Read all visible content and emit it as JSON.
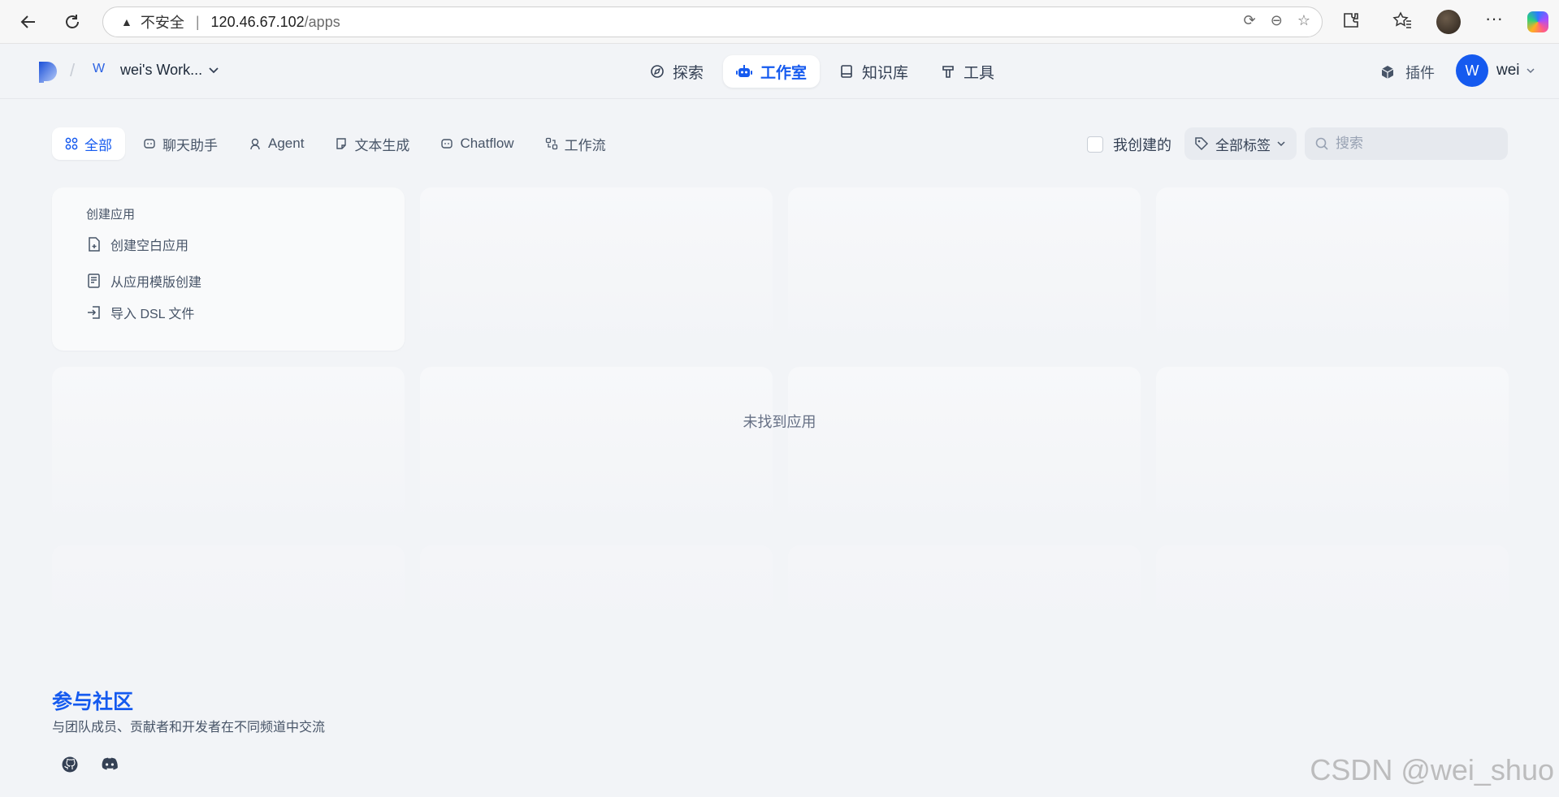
{
  "browser": {
    "insecure_label": "不安全",
    "url_host": "120.46.67.102",
    "url_path": "/apps"
  },
  "header": {
    "workspace_initial": "W",
    "workspace_name": "wei's Work...",
    "nav": [
      {
        "label": "探索",
        "icon": "compass-icon"
      },
      {
        "label": "工作室",
        "icon": "robot-icon"
      },
      {
        "label": "知识库",
        "icon": "book-icon"
      },
      {
        "label": "工具",
        "icon": "hammer-icon"
      }
    ],
    "plugins_label": "插件",
    "avatar_initial": "W",
    "username": "wei"
  },
  "tabs": [
    {
      "label": "全部",
      "icon": "grid-icon"
    },
    {
      "label": "聊天助手",
      "icon": "chat-icon"
    },
    {
      "label": "Agent",
      "icon": "agent-icon"
    },
    {
      "label": "文本生成",
      "icon": "document-icon"
    },
    {
      "label": "Chatflow",
      "icon": "chatflow-icon"
    },
    {
      "label": "工作流",
      "icon": "workflow-icon"
    }
  ],
  "filters": {
    "mine_label": "我创建的",
    "tags_label": "全部标签",
    "search_placeholder": "搜索"
  },
  "create": {
    "title": "创建应用",
    "items": [
      "创建空白应用",
      "从应用模版创建",
      "导入 DSL 文件"
    ]
  },
  "empty_message": "未找到应用",
  "community": {
    "title": "参与社区",
    "description": "与团队成员、贡献者和开发者在不同频道中交流"
  },
  "watermark": "CSDN @wei_shuo",
  "colors": {
    "accent": "#155aef",
    "page_bg": "#f2f4f7"
  }
}
